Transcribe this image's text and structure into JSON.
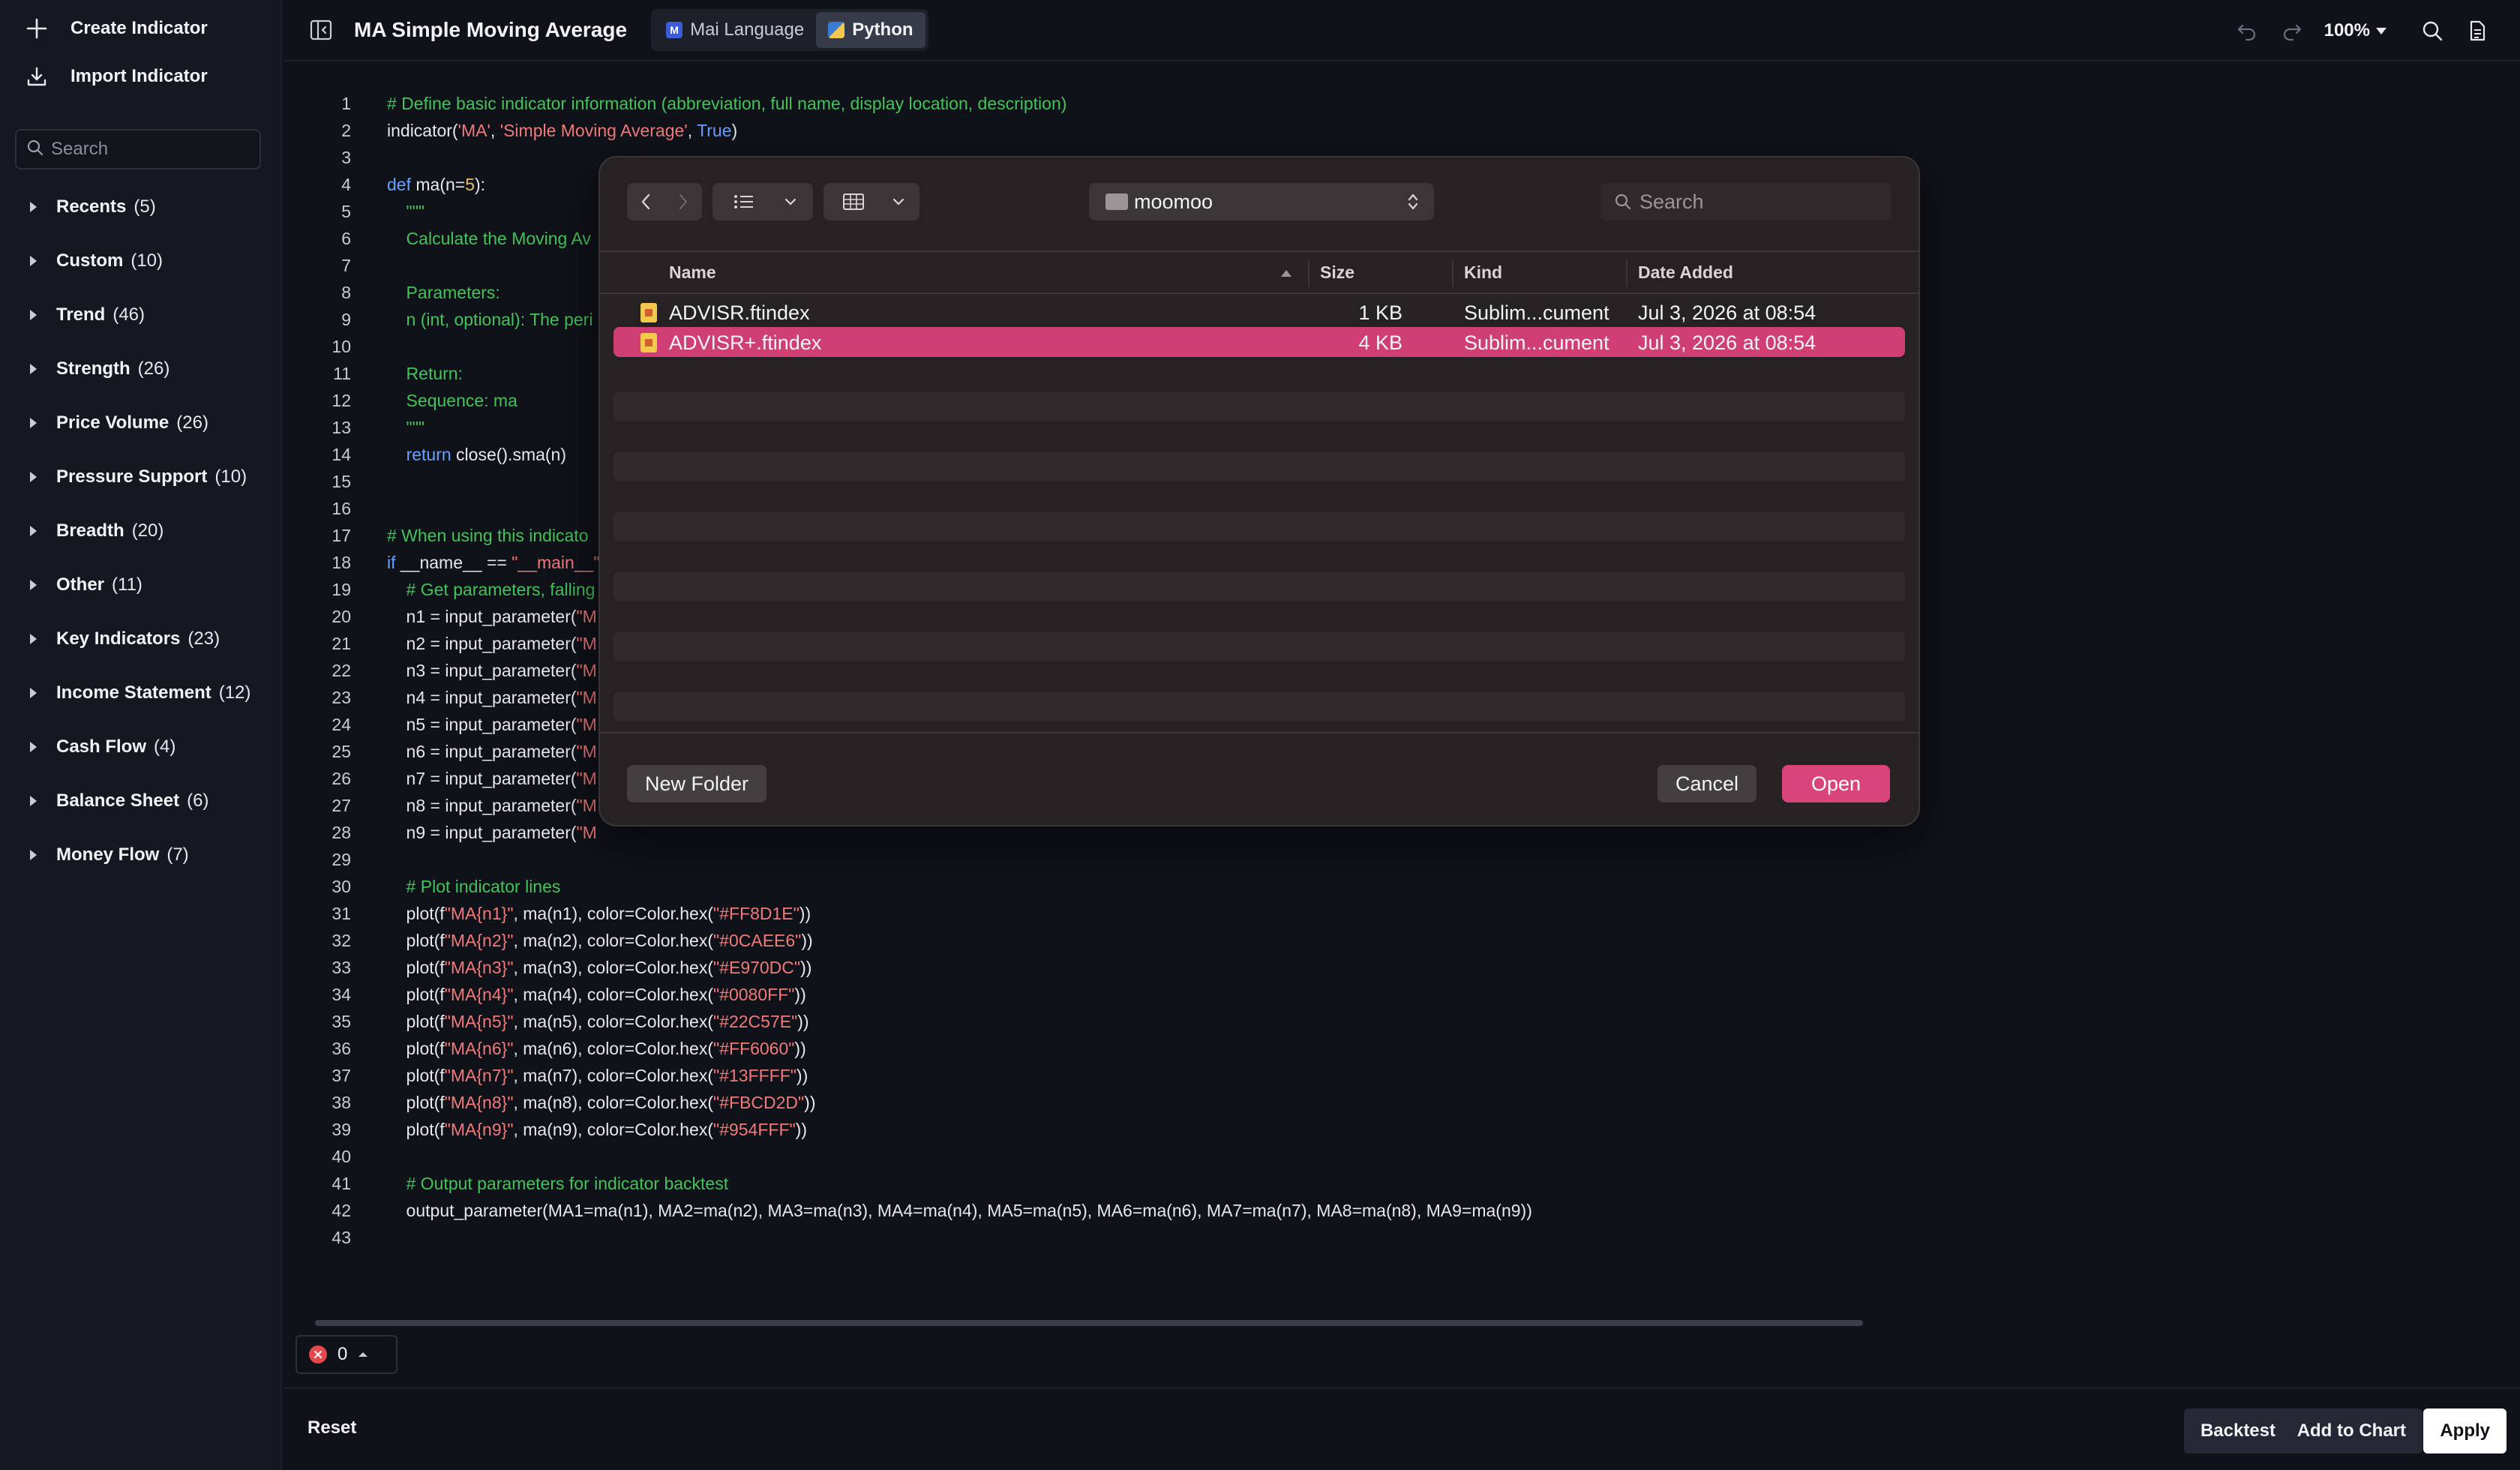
{
  "sidebar": {
    "create_label": "Create Indicator",
    "import_label": "Import Indicator",
    "search_placeholder": "Search",
    "categories": [
      {
        "name": "Recents",
        "count": "(5)"
      },
      {
        "name": "Custom",
        "count": "(10)"
      },
      {
        "name": "Trend",
        "count": "(46)"
      },
      {
        "name": "Strength",
        "count": "(26)"
      },
      {
        "name": "Price Volume",
        "count": "(26)"
      },
      {
        "name": "Pressure Support",
        "count": "(10)"
      },
      {
        "name": "Breadth",
        "count": "(20)"
      },
      {
        "name": "Other",
        "count": "(11)"
      },
      {
        "name": "Key Indicators",
        "count": "(23)"
      },
      {
        "name": "Income Statement",
        "count": "(12)"
      },
      {
        "name": "Cash Flow",
        "count": "(4)"
      },
      {
        "name": "Balance Sheet",
        "count": "(6)"
      },
      {
        "name": "Money Flow",
        "count": "(7)"
      }
    ]
  },
  "topbar": {
    "title": "MA Simple Moving Average",
    "tabs": [
      {
        "label": "Mai Language",
        "badge": "M",
        "active": false
      },
      {
        "label": "Python",
        "badge": "P",
        "active": true
      }
    ],
    "zoom": "100%"
  },
  "editor": {
    "lines": [
      {
        "n": "1",
        "code": [
          [
            "c",
            "# Define basic indicator information (abbreviation, full name, display location, description)"
          ]
        ]
      },
      {
        "n": "2",
        "code": [
          [
            "t",
            "indicator("
          ],
          [
            "s",
            "'MA'"
          ],
          [
            "t",
            ", "
          ],
          [
            "s",
            "'Simple Moving Average'"
          ],
          [
            "t",
            ", "
          ],
          [
            "k",
            "True"
          ],
          [
            "t",
            ")"
          ]
        ]
      },
      {
        "n": "3",
        "code": []
      },
      {
        "n": "4",
        "code": [
          [
            "k",
            "def"
          ],
          [
            "t",
            " ma(n="
          ],
          [
            "n",
            "5"
          ],
          [
            "t",
            "):"
          ]
        ]
      },
      {
        "n": "5",
        "code": [
          [
            "c",
            "    \"\"\""
          ]
        ]
      },
      {
        "n": "6",
        "code": [
          [
            "c",
            "    Calculate the Moving Av"
          ]
        ]
      },
      {
        "n": "7",
        "code": []
      },
      {
        "n": "8",
        "code": [
          [
            "c",
            "    Parameters:"
          ]
        ]
      },
      {
        "n": "9",
        "code": [
          [
            "c",
            "    n (int, optional): The peri"
          ]
        ]
      },
      {
        "n": "10",
        "code": []
      },
      {
        "n": "11",
        "code": [
          [
            "c",
            "    Return:"
          ]
        ]
      },
      {
        "n": "12",
        "code": [
          [
            "c",
            "    Sequence: ma"
          ]
        ]
      },
      {
        "n": "13",
        "code": [
          [
            "c",
            "    \"\"\""
          ]
        ]
      },
      {
        "n": "14",
        "code": [
          [
            "t",
            "    "
          ],
          [
            "k",
            "return"
          ],
          [
            "t",
            " close().sma(n)"
          ]
        ]
      },
      {
        "n": "15",
        "code": []
      },
      {
        "n": "16",
        "code": []
      },
      {
        "n": "17",
        "code": [
          [
            "c",
            "# When using this indicato"
          ]
        ]
      },
      {
        "n": "18",
        "code": [
          [
            "k",
            "if"
          ],
          [
            "t",
            " __name__ == "
          ],
          [
            "s",
            "\"__main__\""
          ],
          [
            "t",
            ":"
          ]
        ]
      },
      {
        "n": "19",
        "code": [
          [
            "c",
            "    # Get parameters, falling"
          ]
        ]
      },
      {
        "n": "20",
        "code": [
          [
            "t",
            "    n1 = input_parameter("
          ],
          [
            "s",
            "\"M"
          ]
        ]
      },
      {
        "n": "21",
        "code": [
          [
            "t",
            "    n2 = input_parameter("
          ],
          [
            "s",
            "\"M"
          ]
        ]
      },
      {
        "n": "22",
        "code": [
          [
            "t",
            "    n3 = input_parameter("
          ],
          [
            "s",
            "\"M"
          ]
        ]
      },
      {
        "n": "23",
        "code": [
          [
            "t",
            "    n4 = input_parameter("
          ],
          [
            "s",
            "\"M"
          ]
        ]
      },
      {
        "n": "24",
        "code": [
          [
            "t",
            "    n5 = input_parameter("
          ],
          [
            "s",
            "\"M"
          ]
        ]
      },
      {
        "n": "25",
        "code": [
          [
            "t",
            "    n6 = input_parameter("
          ],
          [
            "s",
            "\"M"
          ]
        ]
      },
      {
        "n": "26",
        "code": [
          [
            "t",
            "    n7 = input_parameter("
          ],
          [
            "s",
            "\"M"
          ]
        ]
      },
      {
        "n": "27",
        "code": [
          [
            "t",
            "    n8 = input_parameter("
          ],
          [
            "s",
            "\"M"
          ]
        ]
      },
      {
        "n": "28",
        "code": [
          [
            "t",
            "    n9 = input_parameter("
          ],
          [
            "s",
            "\"M"
          ]
        ]
      },
      {
        "n": "29",
        "code": []
      },
      {
        "n": "30",
        "code": [
          [
            "c",
            "    # Plot indicator lines"
          ]
        ]
      },
      {
        "n": "31",
        "code": [
          [
            "t",
            "    plot(f"
          ],
          [
            "s",
            "\"MA{n1}\""
          ],
          [
            "t",
            ", ma(n1), color=Color.hex("
          ],
          [
            "s",
            "\"#FF8D1E\""
          ],
          [
            "t",
            "))"
          ]
        ]
      },
      {
        "n": "32",
        "code": [
          [
            "t",
            "    plot(f"
          ],
          [
            "s",
            "\"MA{n2}\""
          ],
          [
            "t",
            ", ma(n2), color=Color.hex("
          ],
          [
            "s",
            "\"#0CAEE6\""
          ],
          [
            "t",
            "))"
          ]
        ]
      },
      {
        "n": "33",
        "code": [
          [
            "t",
            "    plot(f"
          ],
          [
            "s",
            "\"MA{n3}\""
          ],
          [
            "t",
            ", ma(n3), color=Color.hex("
          ],
          [
            "s",
            "\"#E970DC\""
          ],
          [
            "t",
            "))"
          ]
        ]
      },
      {
        "n": "34",
        "code": [
          [
            "t",
            "    plot(f"
          ],
          [
            "s",
            "\"MA{n4}\""
          ],
          [
            "t",
            ", ma(n4), color=Color.hex("
          ],
          [
            "s",
            "\"#0080FF\""
          ],
          [
            "t",
            "))"
          ]
        ]
      },
      {
        "n": "35",
        "code": [
          [
            "t",
            "    plot(f"
          ],
          [
            "s",
            "\"MA{n5}\""
          ],
          [
            "t",
            ", ma(n5), color=Color.hex("
          ],
          [
            "s",
            "\"#22C57E\""
          ],
          [
            "t",
            "))"
          ]
        ]
      },
      {
        "n": "36",
        "code": [
          [
            "t",
            "    plot(f"
          ],
          [
            "s",
            "\"MA{n6}\""
          ],
          [
            "t",
            ", ma(n6), color=Color.hex("
          ],
          [
            "s",
            "\"#FF6060\""
          ],
          [
            "t",
            "))"
          ]
        ]
      },
      {
        "n": "37",
        "code": [
          [
            "t",
            "    plot(f"
          ],
          [
            "s",
            "\"MA{n7}\""
          ],
          [
            "t",
            ", ma(n7), color=Color.hex("
          ],
          [
            "s",
            "\"#13FFFF\""
          ],
          [
            "t",
            "))"
          ]
        ]
      },
      {
        "n": "38",
        "code": [
          [
            "t",
            "    plot(f"
          ],
          [
            "s",
            "\"MA{n8}\""
          ],
          [
            "t",
            ", ma(n8), color=Color.hex("
          ],
          [
            "s",
            "\"#FBCD2D\""
          ],
          [
            "t",
            "))"
          ]
        ]
      },
      {
        "n": "39",
        "code": [
          [
            "t",
            "    plot(f"
          ],
          [
            "s",
            "\"MA{n9}\""
          ],
          [
            "t",
            ", ma(n9), color=Color.hex("
          ],
          [
            "s",
            "\"#954FFF\""
          ],
          [
            "t",
            "))"
          ]
        ]
      },
      {
        "n": "40",
        "code": []
      },
      {
        "n": "41",
        "code": [
          [
            "c",
            "    # Output parameters for indicator backtest"
          ]
        ]
      },
      {
        "n": "42",
        "code": [
          [
            "t",
            "    output_parameter(MA1=ma(n1), MA2=ma(n2), MA3=ma(n3), MA4=ma(n4), MA5=ma(n5), MA6=ma(n6), MA7=ma(n7), MA8=ma(n8), MA9=ma(n9))"
          ]
        ]
      },
      {
        "n": "43",
        "code": []
      }
    ]
  },
  "status": {
    "error_count": "0"
  },
  "footer": {
    "reset_label": "Reset",
    "backtest_label": "Backtest",
    "add_to_chart_label": "Add to Chart",
    "apply_label": "Apply"
  },
  "dialog": {
    "folder": "moomoo",
    "search_placeholder": "Search",
    "columns": {
      "name": "Name",
      "size": "Size",
      "kind": "Kind",
      "date_added": "Date Added"
    },
    "files": [
      {
        "name": "ADVISR.ftindex",
        "size": "1 KB",
        "kind": "Sublim...cument",
        "date": "Jul 3, 2026 at 08:54",
        "selected": false
      },
      {
        "name": "ADVISR+.ftindex",
        "size": "4 KB",
        "kind": "Sublim...cument",
        "date": "Jul 3, 2026 at 08:54",
        "selected": true
      }
    ],
    "new_folder_label": "New Folder",
    "cancel_label": "Cancel",
    "open_label": "Open"
  },
  "colors": {
    "accent": "#d9457a",
    "selection": "#cf3f73",
    "comment": "#46c25a",
    "string": "#f07a7a",
    "keyword": "#6aa0ff",
    "error": "#e5484d"
  }
}
